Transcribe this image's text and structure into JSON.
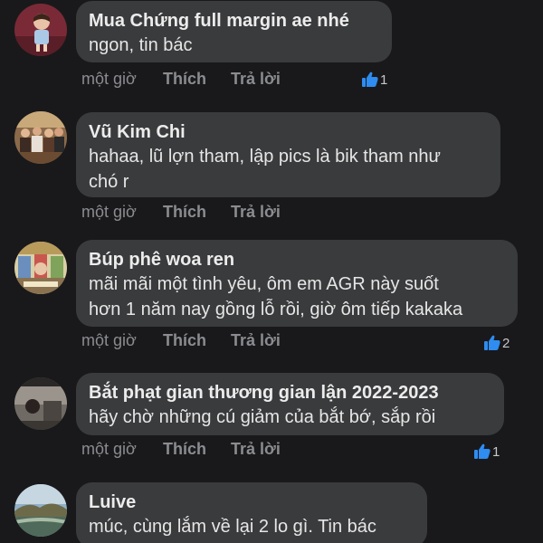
{
  "colors": {
    "background": "#19191b",
    "bubble": "#3a3b3d",
    "meta_text": "#8b8c90",
    "like_blue": "#2f8cf0"
  },
  "comments": [
    {
      "author": "Mua Chứng full margin ae nhé",
      "lines": [
        "ngon, tin bác"
      ],
      "time": "một giờ",
      "like_label": "Thích",
      "reply_label": "Trả lời",
      "reactions": "1",
      "reaction_icon": "thumbs-up-icon"
    },
    {
      "author": "Vũ Kim Chi",
      "lines": [
        "hahaa, lũ lợn tham, lập pics là bik tham như",
        "chó r"
      ],
      "time": "một giờ",
      "like_label": "Thích",
      "reply_label": "Trả lời"
    },
    {
      "author": "Búp phê woa ren",
      "lines": [
        "mãi mãi một tình yêu, ôm em AGR này suốt",
        "hơn 1 năm nay gồng lỗ rồi, giờ ôm tiếp kakaka"
      ],
      "time": "một giờ",
      "like_label": "Thích",
      "reply_label": "Trả lời",
      "reactions": "2",
      "reaction_icon": "thumbs-up-icon"
    },
    {
      "author": "Bắt phạt gian thương gian lận 2022-2023",
      "lines": [
        "hãy chờ những cú giảm của bắt bớ, sắp rồi"
      ],
      "time": "một giờ",
      "like_label": "Thích",
      "reply_label": "Trả lời",
      "reactions": "1",
      "reaction_icon": "thumbs-up-icon"
    },
    {
      "author": "Luive",
      "lines": [
        "múc, cùng lắm về lại 2 lo gì. Tin bác"
      ]
    }
  ]
}
